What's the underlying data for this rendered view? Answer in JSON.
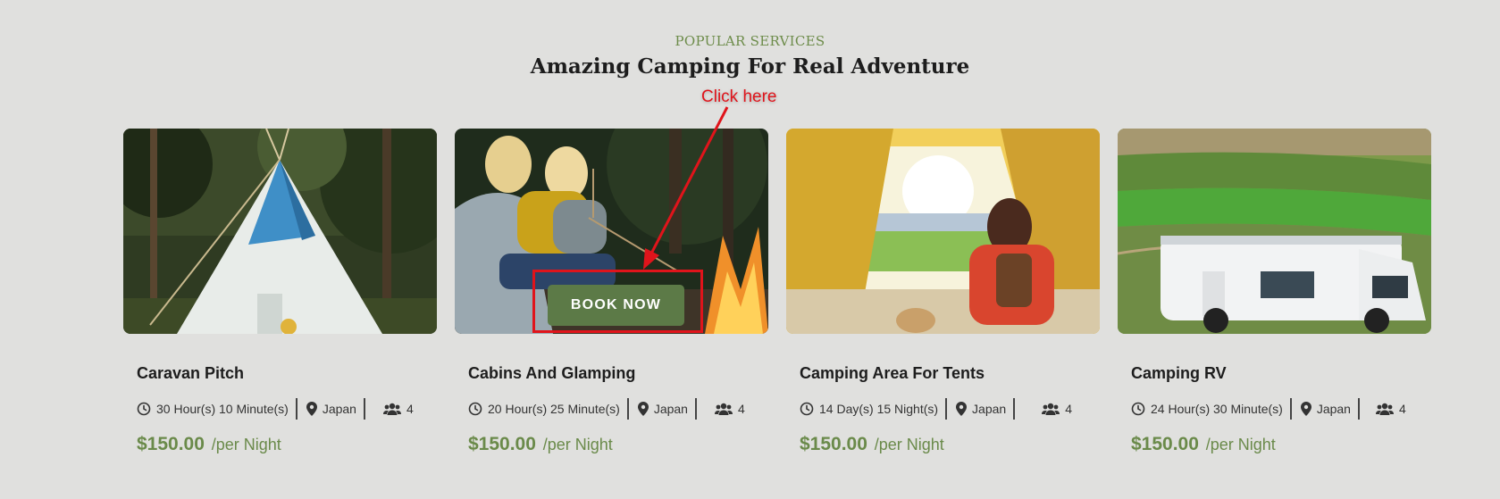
{
  "section": {
    "subtitle": "POPULAR SERVICES",
    "title": "Amazing Camping For Real Adventure"
  },
  "annotation": {
    "label": "Click here",
    "color": "#e0141b"
  },
  "accent_color": "#5c7a47",
  "cards": [
    {
      "title": "Caravan Pitch",
      "duration": "30 Hour(s) 10 Minute(s)",
      "location": "Japan",
      "guests": "4",
      "price": "$150.00",
      "unit": "/per Night",
      "image": "teepee-tent-forest"
    },
    {
      "title": "Cabins And Glamping",
      "duration": "20 Hour(s) 25 Minute(s)",
      "location": "Japan",
      "guests": "4",
      "price": "$150.00",
      "unit": "/per Night",
      "image": "campfire-friends",
      "button": "BOOK NOW"
    },
    {
      "title": "Camping Area For Tents",
      "duration": "14 Day(s) 15 Night(s)",
      "location": "Japan",
      "guests": "4",
      "price": "$150.00",
      "unit": "/per Night",
      "image": "inside-tent-view"
    },
    {
      "title": "Camping RV",
      "duration": "24 Hour(s) 30 Minute(s)",
      "location": "Japan",
      "guests": "4",
      "price": "$150.00",
      "unit": "/per Night",
      "image": "rv-green-valley"
    }
  ]
}
